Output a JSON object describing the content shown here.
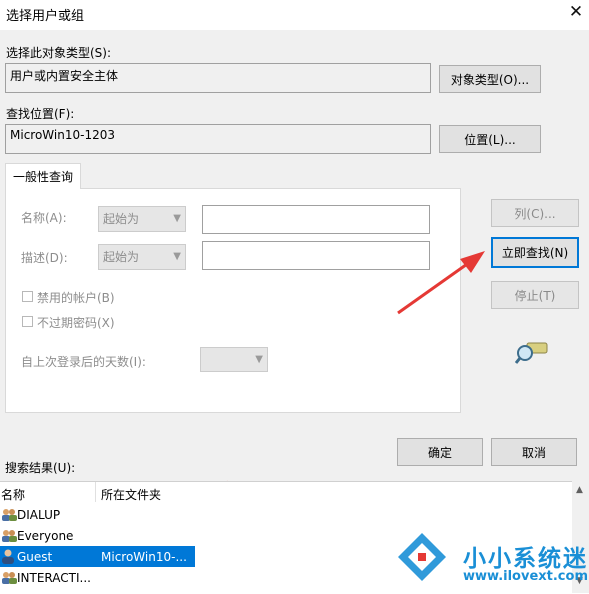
{
  "window": {
    "title": "选择用户或组",
    "close_glyph": "✕"
  },
  "object_type": {
    "label": "选择此对象类型(S):",
    "value": "用户或内置安全主体",
    "button": "对象类型(O)..."
  },
  "location": {
    "label": "查找位置(F):",
    "value": "MicroWin10-1203",
    "button": "位置(L)..."
  },
  "query": {
    "tab": "一般性查询",
    "name_label": "名称(A):",
    "name_combo": "起始为",
    "desc_label": "描述(D):",
    "desc_combo": "起始为",
    "disabled_accounts": "禁用的帐户(B)",
    "no_expire_pwd": "不过期密码(X)",
    "days_label": "自上次登录后的天数(I):"
  },
  "side_buttons": {
    "columns": "列(C)...",
    "find_now": "立即查找(N)",
    "stop": "停止(T)"
  },
  "footer_buttons": {
    "ok": "确定",
    "cancel": "取消"
  },
  "results": {
    "label": "搜索结果(U):",
    "col_name": "名称",
    "col_folder": "所在文件夹",
    "rows": [
      {
        "name": "DIALUP",
        "folder": ""
      },
      {
        "name": "Everyone",
        "folder": ""
      },
      {
        "name": "Guest",
        "folder": "MicroWin10-..."
      },
      {
        "name": "INTERACTI...",
        "folder": ""
      }
    ]
  },
  "watermark": {
    "title": "小小系统迷",
    "url": "www.ilovext.com"
  },
  "colors": {
    "accent": "#0078d7",
    "arrow": "#e53935",
    "watermark": "#1a8fd6"
  }
}
